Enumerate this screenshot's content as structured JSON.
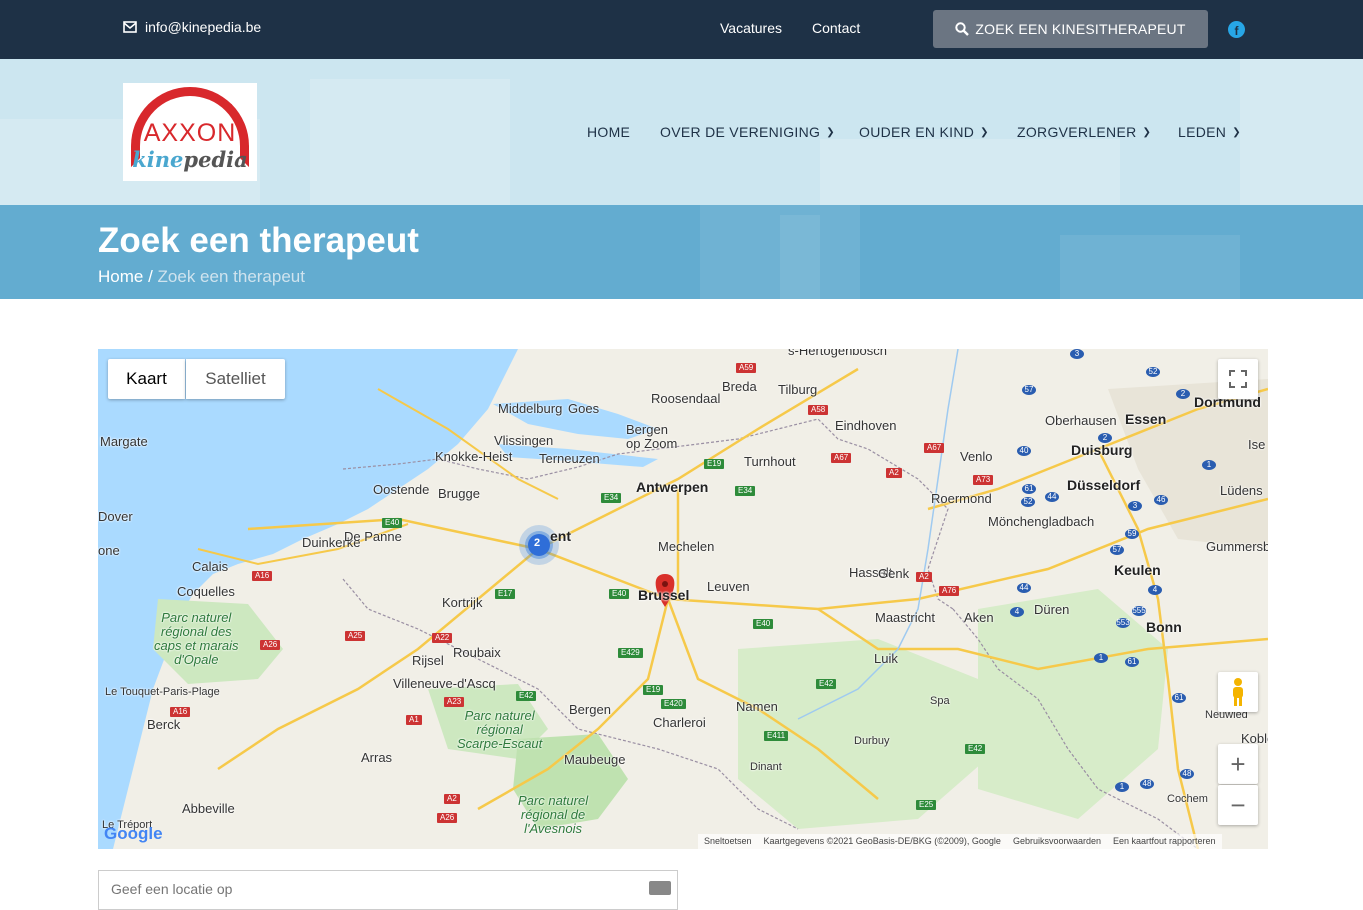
{
  "topbar": {
    "email": "info@kinepedia.be",
    "links": [
      "Vacatures",
      "Contact"
    ],
    "search_button": "ZOEK EEN KINESITHERAPEUT"
  },
  "logo": {
    "top": "AXXON",
    "bottom_1": "kine",
    "bottom_2": "pedia"
  },
  "nav": {
    "items": [
      {
        "label": "HOME"
      },
      {
        "label": "OVER DE VERENIGING"
      },
      {
        "label": "OUDER EN KIND"
      },
      {
        "label": "ZORGVERLENER"
      },
      {
        "label": "LEDEN"
      }
    ]
  },
  "banner": {
    "title": "Zoek een therapeut",
    "breadcrumb_home": "Home",
    "breadcrumb_sep": " / ",
    "breadcrumb_current": "Zoek een therapeut"
  },
  "map": {
    "type_map": "Kaart",
    "type_satellite": "Satelliet",
    "cluster_count": "2",
    "places": {
      "shertogenbosch": "s-Hertogenbosch",
      "breda": "Breda",
      "tilburg": "Tilburg",
      "roosendaal": "Roosendaal",
      "middelburg": "Middelburg",
      "goes": "Goes",
      "bergen_op_zoom": "Bergen\nop Zoom",
      "vlissingen": "Vlissingen",
      "eindhoven": "Eindhoven",
      "oberhausen": "Oberhausen",
      "essen": "Essen",
      "dortmund": "Dortmund",
      "margate": "Margate",
      "knokke": "Knokke-Heist",
      "terneuzen": "Terneuzen",
      "turnhout": "Turnhout",
      "venlo": "Venlo",
      "duisburg": "Duisburg",
      "ise": "Ise",
      "oostende": "Oostende",
      "brugge": "Brugge",
      "antwerpen": "Antwerpen",
      "roermond": "Roermond",
      "dusseldorf": "Düsseldorf",
      "ludens": "Lüdens",
      "dover": "Dover",
      "gent": "ent",
      "mechelen": "Mechelen",
      "monchengladbach": "Mönchengladbach",
      "duinkerke": "Duinkerke",
      "de_panne": "De Panne",
      "one": "one",
      "gummersb": "Gummersb",
      "calais": "Calais",
      "brussel": "Brussel",
      "leuven": "Leuven",
      "hasselt": "Hasselt",
      "genk": "Genk",
      "keulen": "Keulen",
      "coquelles": "Coquelles",
      "kortrijk": "Kortrijk",
      "maastricht": "Maastricht",
      "aken": "Aken",
      "duren": "Düren",
      "bonn": "Bonn",
      "rijsel": "Rijsel",
      "roubaix": "Roubaix",
      "luik": "Luik",
      "villeneuve": "Villeneuve-d'Ascq",
      "le_touquet": "Le Touquet-Paris-Plage",
      "bergen": "Bergen",
      "namen": "Namen",
      "spa": "Spa",
      "neuwied": "Neuwied",
      "charleroi": "Charleroi",
      "berck": "Berck",
      "kobler": "Kobler",
      "durbuy": "Durbuy",
      "arras": "Arras",
      "maubeuge": "Maubeuge",
      "dinant": "Dinant",
      "cochem": "Cochem",
      "abbeville": "Abbeville",
      "le_treport": "Le Tréport"
    },
    "parks": {
      "opale": "Parc naturel\nrégional des\ncaps et marais\nd'Opale",
      "scarpe": "Parc naturel\nrégional\nScarpe-Escaut",
      "avesnois": "Parc naturel\nrégional de\nl'Avesnois"
    },
    "attribution": [
      "Sneltoetsen",
      "Kaartgegevens ©2021 GeoBasis-DE/BKG (©2009), Google",
      "Gebruiksvoorwaarden",
      "Een kaartfout rapporteren"
    ],
    "google_logo": "Google"
  },
  "search": {
    "placeholder": "Geef een locatie op"
  }
}
